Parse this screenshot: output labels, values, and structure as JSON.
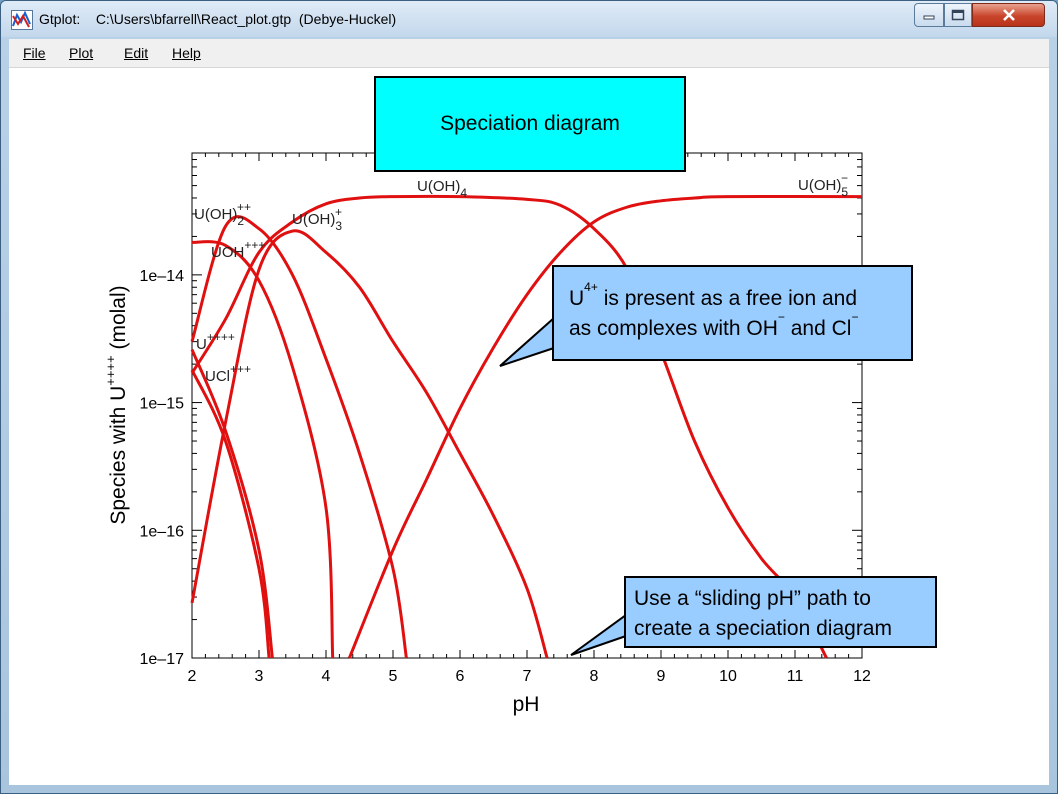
{
  "window": {
    "app_name": "Gtplot:",
    "title": "C:\\Users\\bfarrell\\React_plot.gtp  (Debye-Huckel)",
    "minimize_label": "—",
    "maximize_label": "□",
    "close_label": "✕",
    "icon": "gtplot-app-icon"
  },
  "menu": {
    "items": [
      {
        "label": "File"
      },
      {
        "label": "Plot"
      },
      {
        "label": "Edit"
      },
      {
        "label": "Help"
      }
    ]
  },
  "annotations": {
    "title_box": "Speciation diagram",
    "callout1_line1_pre": "U",
    "callout1_line1_sup": "4+",
    "callout1_line1_post": " is present as a free ion and",
    "callout1_line2_pre": "as complexes with OH",
    "callout1_line2_sup1": "−",
    "callout1_line2_mid": " and Cl",
    "callout1_line2_sup2": "−",
    "callout2_line1": "Use a “sliding pH” path to",
    "callout2_line2": "create a speciation diagram"
  },
  "colors": {
    "series": "#e01010",
    "title_box": "#00ffff",
    "callout": "#99ccff"
  },
  "chart_data": {
    "type": "line",
    "xlabel": "pH",
    "ylabel_pre": "Species with U",
    "ylabel_sup": "++++",
    "ylabel_post": " (molal)",
    "xlim": [
      2,
      12
    ],
    "ylim": [
      1e-17,
      9e-14
    ],
    "yscale": "log",
    "xticks": [
      "2",
      "3",
      "4",
      "5",
      "6",
      "7",
      "8",
      "9",
      "10",
      "11",
      "12"
    ],
    "yticks": [
      {
        "value": 1e-17,
        "label": "1e–17"
      },
      {
        "value": 1e-16,
        "label": "1e–16"
      },
      {
        "value": 1e-15,
        "label": "1e–15"
      },
      {
        "value": 1e-14,
        "label": "1e–14"
      }
    ],
    "series": [
      {
        "name": "U++++",
        "label_base": "U",
        "label_sup": "++++",
        "label_sub": "",
        "points": [
          [
            2.0,
            2.6e-15
          ],
          [
            2.5,
            6e-16
          ],
          [
            3.0,
            7e-17
          ],
          [
            3.2,
            1e-17
          ]
        ]
      },
      {
        "name": "UCl+++",
        "label_base": "UCl",
        "label_sup": "+++",
        "label_sub": "",
        "points": [
          [
            2.0,
            1.8e-15
          ],
          [
            2.5,
            5e-16
          ],
          [
            3.0,
            5e-17
          ],
          [
            3.15,
            1e-17
          ]
        ]
      },
      {
        "name": "UOH+++",
        "label_base": "UOH",
        "label_sup": "+++",
        "label_sub": "",
        "points": [
          [
            2.0,
            1.8e-14
          ],
          [
            2.5,
            1.7e-14
          ],
          [
            3.0,
            9e-15
          ],
          [
            3.5,
            1.9e-15
          ],
          [
            4.0,
            1.5e-16
          ],
          [
            4.1,
            1e-17
          ]
        ]
      },
      {
        "name": "U(OH)2++",
        "label_base": "U(OH)",
        "label_sup": "++",
        "label_sub": "2",
        "points": [
          [
            2.0,
            3e-15
          ],
          [
            2.5,
            2.4e-14
          ],
          [
            3.0,
            2.3e-14
          ],
          [
            3.5,
            1e-14
          ],
          [
            4.0,
            2.2e-15
          ],
          [
            4.5,
            4e-16
          ],
          [
            5.0,
            5e-17
          ],
          [
            5.2,
            1e-17
          ]
        ]
      },
      {
        "name": "U(OH)3+",
        "label_base": "U(OH)",
        "label_sup": "+",
        "label_sub": "3",
        "points": [
          [
            2.0,
            2.7e-17
          ],
          [
            2.5,
            7e-16
          ],
          [
            3.0,
            1.1e-14
          ],
          [
            3.5,
            2.2e-14
          ],
          [
            4.0,
            1.5e-14
          ],
          [
            4.5,
            8e-15
          ],
          [
            5.0,
            3e-15
          ],
          [
            5.5,
            1.2e-15
          ],
          [
            6.0,
            4e-16
          ],
          [
            6.5,
            1.3e-16
          ],
          [
            7.0,
            3.5e-17
          ],
          [
            7.3,
            1e-17
          ]
        ]
      },
      {
        "name": "U(OH)4",
        "label_base": "U(OH)",
        "label_sup": "",
        "label_sub": "4",
        "points": [
          [
            2.0,
            1.7e-15
          ],
          [
            2.5,
            4.5e-15
          ],
          [
            3.0,
            1.5e-14
          ],
          [
            3.5,
            2.6e-14
          ],
          [
            4.0,
            3.6e-14
          ],
          [
            4.5,
            4e-14
          ],
          [
            5.0,
            4.1e-14
          ],
          [
            6.0,
            4.1e-14
          ],
          [
            7.0,
            3.9e-14
          ],
          [
            7.5,
            3.5e-14
          ],
          [
            8.0,
            2.3e-14
          ],
          [
            8.5,
            1.1e-14
          ],
          [
            9.0,
            2.5e-15
          ],
          [
            9.5,
            5e-16
          ],
          [
            10.0,
            1.5e-16
          ],
          [
            10.5,
            6e-17
          ],
          [
            11.0,
            3e-17
          ],
          [
            11.47,
            1e-17
          ]
        ]
      },
      {
        "name": "U(OH)5-",
        "label_base": "U(OH)",
        "label_sup": "−",
        "label_sub": "5",
        "points": [
          [
            4.35,
            1e-17
          ],
          [
            5.0,
            7e-17
          ],
          [
            5.5,
            2.5e-16
          ],
          [
            6.0,
            9e-16
          ],
          [
            6.5,
            2.7e-15
          ],
          [
            7.0,
            7e-15
          ],
          [
            7.5,
            1.5e-14
          ],
          [
            8.0,
            2.6e-14
          ],
          [
            8.5,
            3.4e-14
          ],
          [
            9.0,
            3.8e-14
          ],
          [
            9.5,
            4e-14
          ],
          [
            10.0,
            4.1e-14
          ],
          [
            12.0,
            4.1e-14
          ]
        ]
      }
    ]
  }
}
